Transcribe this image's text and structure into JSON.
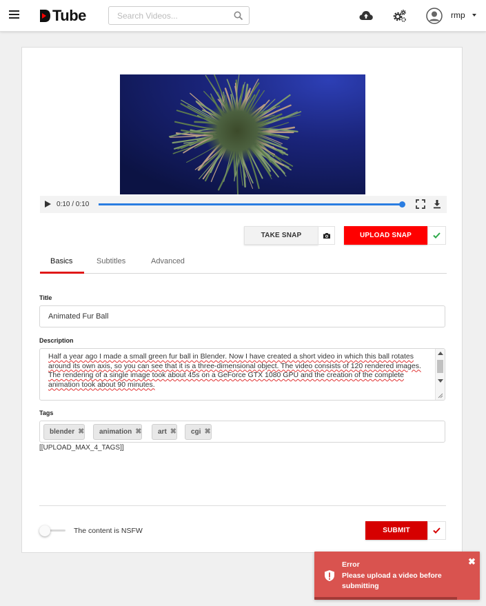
{
  "header": {
    "logo_text": "Tube",
    "search_placeholder": "Search Videos...",
    "username": "rmp",
    "icons": [
      "menu-icon",
      "upload-cloud-icon",
      "settings-gears-icon",
      "account-icon"
    ]
  },
  "player": {
    "time": "0:10 / 0:10",
    "progress": 1.0
  },
  "snap": {
    "take_label": "TAKE SNAP",
    "upload_label": "UPLOAD SNAP"
  },
  "tabs": [
    {
      "label": "Basics",
      "active": true
    },
    {
      "label": "Subtitles",
      "active": false
    },
    {
      "label": "Advanced",
      "active": false
    }
  ],
  "form": {
    "title_label": "Title",
    "title_value": "Animated Fur Ball",
    "description_label": "Description",
    "description_value": "Half a year ago I made a small green fur ball in Blender. Now I have created a short video in which this ball rotates around its own axis, so you can see that it is a three-dimensional object.  The video consists of 120 rendered images. The rendering of a single image took about 45s on a GeForce GTX 1080 GPU and the creation of the complete animation took about 90 minutes.",
    "tags_label": "Tags",
    "tags": [
      "blender",
      "animation",
      "art",
      "cgi"
    ],
    "tags_note": "[[UPLOAD_MAX_4_TAGS]]",
    "nsfw_label": "The content is NSFW",
    "nsfw_on": false,
    "submit_label": "SUBMIT"
  },
  "toast": {
    "title": "Error",
    "message": "Please upload a video before submitting"
  },
  "colors": {
    "brand_red": "#ff0000",
    "submit_red": "#d60000",
    "toast_red": "#d9534f",
    "progress_blue": "#2a7de1",
    "check_green": "#2eaa4a"
  }
}
